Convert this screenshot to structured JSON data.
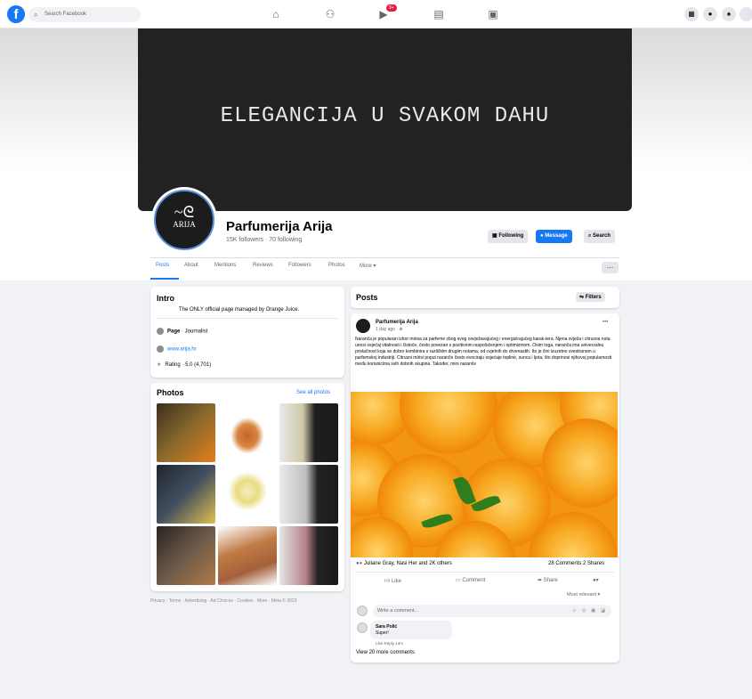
{
  "topbar": {
    "search_placeholder": "Search Facebook",
    "notification_badge": "9+",
    "icons": [
      "home-icon",
      "friends-icon",
      "watch-icon",
      "marketplace-icon",
      "gaming-icon"
    ]
  },
  "cover": {
    "text": "ELEGANCIJA U SVAKOM DAHU"
  },
  "profile": {
    "avatar_text": "ARIJA",
    "name": "Parfumerija Arija",
    "followers": "15K followers · 70 following",
    "following_label": "Following",
    "message_label": "Message",
    "search_label": "Search"
  },
  "tabs": [
    "Posts",
    "About",
    "Mentions",
    "Reviews",
    "Followers",
    "Photos",
    "More ▾"
  ],
  "intro": {
    "title": "Intro",
    "bio": "The ONLY official page managed by Orange Juice.",
    "page_type_bold": "Page",
    "page_type": " · Journalist",
    "website": "www.arija.hr",
    "rating": "Rating · 5.0 (4,701)"
  },
  "photos": {
    "title": "Photos",
    "see_all": "See all photos"
  },
  "footer": "Privacy · Terms · Advertising · Ad Choices · Cookies · More · Meta © 2023",
  "posts_header": {
    "title": "Posts",
    "filters": "Filters"
  },
  "post": {
    "author": "Parfumerija Arija",
    "time": "1 day ago · ⊕",
    "text": "Naranča je popularan izbor mirisa za parfeme zbog svog osvježavajućeg i energizirajućeg karak-tera. Njena svježa i citrusna nota unosi osjećaj vitalnosti i čistoće, često povezan s pozitivnim raspoloženjem i optimizmom. Osim toga, naranča ima univerzalnu privlačnost koja se dobro kombinira s različitim drugim notama, od cvjetnih do drvenastih. Ito je čini izuzetno svestranom u parfemskoj industriji. Citrusni mirisi poput naranče često evociraju osjećaje topline, sunca i ljeta, što doprinosi njihovoj popularnosti među korisnicima svih dobnih skupina. Također, mirs naranče",
    "reactions": "Juliane Gray, Nasi Her and 2K others",
    "stats": "28 Comments  2 Shares",
    "like": "Like",
    "comment": "Comment",
    "share": "Share",
    "most_relevant": "Most relevant ▾",
    "comment_placeholder": "Write a comment...",
    "reply_author": "Sara Polić",
    "reply_text": "Super!",
    "reply_actions": "Like   Reply   14m",
    "view_more": "View 20 more comments"
  }
}
